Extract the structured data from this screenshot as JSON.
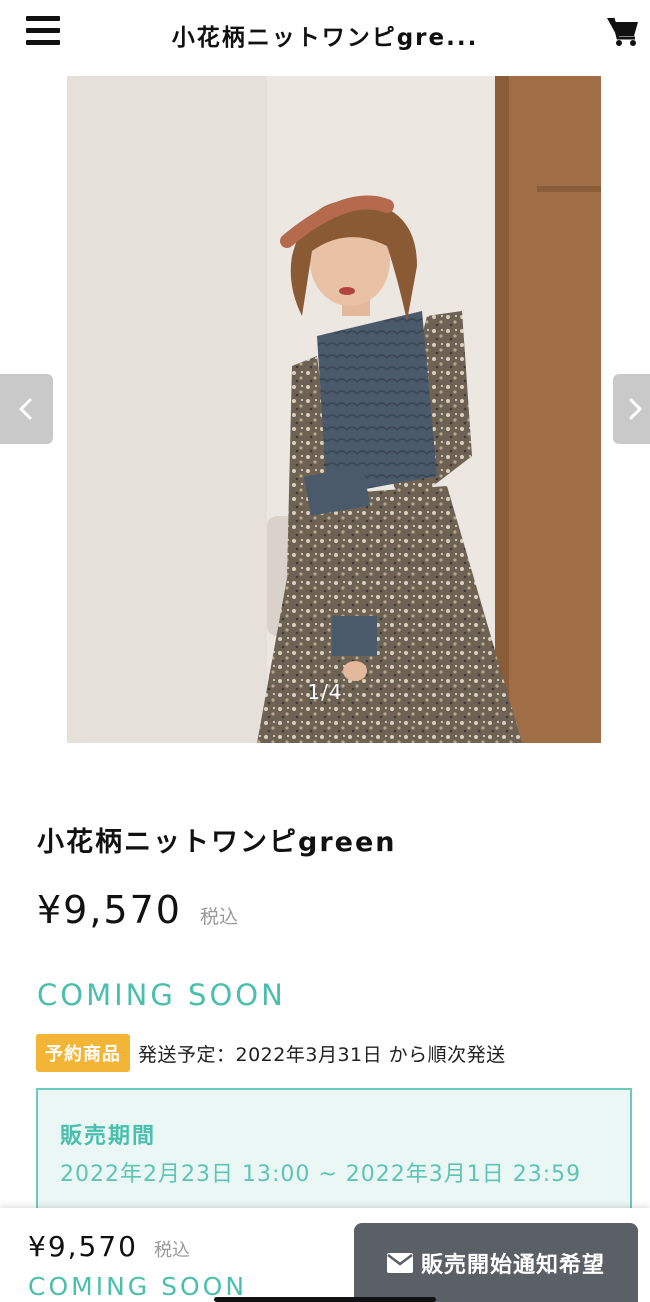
{
  "header": {
    "title": "小花柄ニットワンピgre...",
    "menu_icon": "hamburger-menu-icon",
    "cart_icon": "shopping-cart-icon"
  },
  "gallery": {
    "counter": "1/4",
    "prev_icon": "chevron-left-icon",
    "next_icon": "chevron-right-icon"
  },
  "product": {
    "name": "小花柄ニットワンピgreen",
    "price": "¥9,570",
    "tax_label": "税込",
    "status": "COMING SOON",
    "preorder_badge": "予約商品",
    "shipping_text": "発送予定：2022年3月31日 から順次発送",
    "sales_period_title": "販売期間",
    "sales_period_range": "2022年2月23日 13:00 ~ 2022年3月1日 23:59"
  },
  "footer": {
    "price": "¥9,570",
    "tax_label": "税込",
    "status": "COMING SOON",
    "notify_button_label": "販売開始通知希望",
    "notify_icon": "envelope-icon"
  },
  "colors": {
    "accent_teal": "#4bbfad",
    "badge_orange": "#f3b536",
    "button_gray": "#5b6066"
  }
}
